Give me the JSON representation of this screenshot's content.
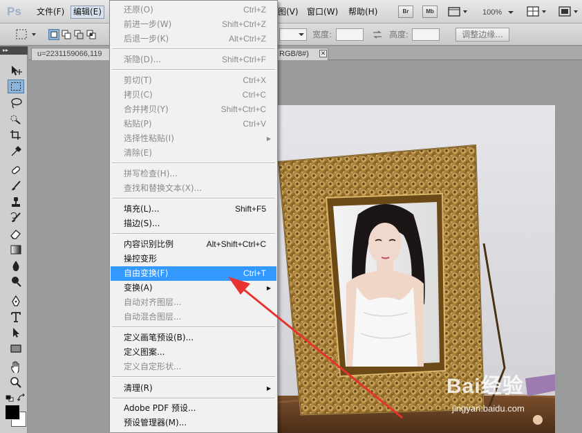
{
  "app": {
    "logo": "Ps"
  },
  "menubar": {
    "items": [
      {
        "label": "文件(F)"
      },
      {
        "label": "编辑(E)"
      },
      {
        "label": "图(V)"
      },
      {
        "label": "窗口(W)"
      },
      {
        "label": "帮助(H)"
      }
    ],
    "bridge_label": "Br",
    "mini_bridge_label": "Mb",
    "zoom": "100%"
  },
  "options": {
    "width_label": "宽度:",
    "height_label": "高度:",
    "refine_edge_label": "调整边缘..."
  },
  "document": {
    "tab_title": "u=2231159066,119",
    "tab_mode": "RGB/8#)",
    "close_symbol": "✕"
  },
  "edit_menu": {
    "items": [
      {
        "label": "还原(O)",
        "shortcut": "Ctrl+Z",
        "disabled": true
      },
      {
        "label": "前进一步(W)",
        "shortcut": "Shift+Ctrl+Z",
        "disabled": true
      },
      {
        "label": "后退一步(K)",
        "shortcut": "Alt+Ctrl+Z",
        "disabled": true
      },
      {
        "label": "渐隐(D)...",
        "shortcut": "Shift+Ctrl+F",
        "disabled": true
      },
      {
        "label": "剪切(T)",
        "shortcut": "Ctrl+X",
        "disabled": true
      },
      {
        "label": "拷贝(C)",
        "shortcut": "Ctrl+C",
        "disabled": true
      },
      {
        "label": "合并拷贝(Y)",
        "shortcut": "Shift+Ctrl+C",
        "disabled": true
      },
      {
        "label": "粘贴(P)",
        "shortcut": "Ctrl+V",
        "disabled": true
      },
      {
        "label": "选择性粘贴(I)",
        "shortcut": "",
        "disabled": true,
        "submenu": true
      },
      {
        "label": "清除(E)",
        "shortcut": "",
        "disabled": true
      },
      {
        "label": "拼写检查(H)...",
        "shortcut": "",
        "disabled": true
      },
      {
        "label": "查找和替换文本(X)...",
        "shortcut": "",
        "disabled": true
      },
      {
        "label": "填充(L)...",
        "shortcut": "Shift+F5",
        "disabled": false
      },
      {
        "label": "描边(S)...",
        "shortcut": "",
        "disabled": false
      },
      {
        "label": "内容识别比例",
        "shortcut": "Alt+Shift+Ctrl+C",
        "disabled": false
      },
      {
        "label": "操控变形",
        "shortcut": "",
        "disabled": false
      },
      {
        "label": "自由变换(F)",
        "shortcut": "Ctrl+T",
        "disabled": false,
        "highlighted": true
      },
      {
        "label": "变换(A)",
        "shortcut": "",
        "disabled": false,
        "submenu": true
      },
      {
        "label": "自动对齐图层...",
        "shortcut": "",
        "disabled": true
      },
      {
        "label": "自动混合图层...",
        "shortcut": "",
        "disabled": true
      },
      {
        "label": "定义画笔预设(B)...",
        "shortcut": "",
        "disabled": false
      },
      {
        "label": "定义图案...",
        "shortcut": "",
        "disabled": false
      },
      {
        "label": "定义自定形状...",
        "shortcut": "",
        "disabled": true
      },
      {
        "label": "清理(R)",
        "shortcut": "",
        "disabled": false,
        "submenu": true
      },
      {
        "label": "Adobe PDF 预设...",
        "shortcut": "",
        "disabled": false
      },
      {
        "label": "预设管理器(M)...",
        "shortcut": "",
        "disabled": false
      }
    ]
  },
  "watermark": {
    "brand": "Bai经验",
    "url": "jingyan.baidu.com"
  },
  "colors": {
    "highlight": "#3399ff",
    "annotation_arrow": "#e8322f"
  }
}
